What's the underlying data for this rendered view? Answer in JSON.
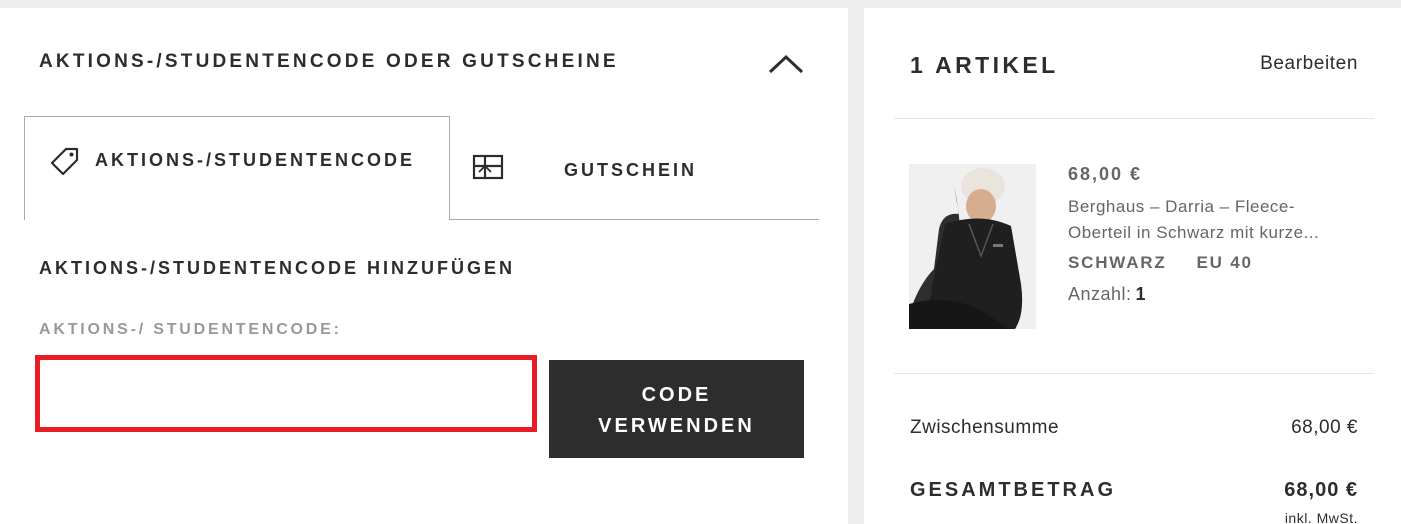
{
  "promo_section": {
    "title": "AKTIONS-/STUDENTENCODE ODER GUTSCHEINE",
    "tabs": [
      {
        "label": "AKTIONS-/STUDENTENCODE",
        "icon": "tag-icon",
        "active": true
      },
      {
        "label": "GUTSCHEIN",
        "icon": "gift-card-icon",
        "active": false
      }
    ],
    "add_title": "AKTIONS-/STUDENTENCODE HINZUFÜGEN",
    "field_label": "AKTIONS-/ STUDENTENCODE:",
    "input_value": "",
    "apply_button_line1": "CODE",
    "apply_button_line2": "VERWENDEN"
  },
  "summary": {
    "items_count": "1 ARTIKEL",
    "edit_label": "Bearbeiten",
    "product": {
      "price": "68,00 €",
      "name": "Berghaus – Darria – Fleece-Oberteil in Schwarz mit kurze...",
      "color": "SCHWARZ",
      "size": "EU 40",
      "qty_label": "Anzahl:",
      "qty_value": "1"
    },
    "subtotal_label": "Zwischensumme",
    "subtotal_value": "68,00 €",
    "total_label": "GESAMTBETRAG",
    "total_value": "68,00 €",
    "vat_note": "inkl. MwSt."
  },
  "colors": {
    "accent_error": "#e81c24",
    "button_dark": "#2d2d2d",
    "background": "#eeeeee"
  }
}
